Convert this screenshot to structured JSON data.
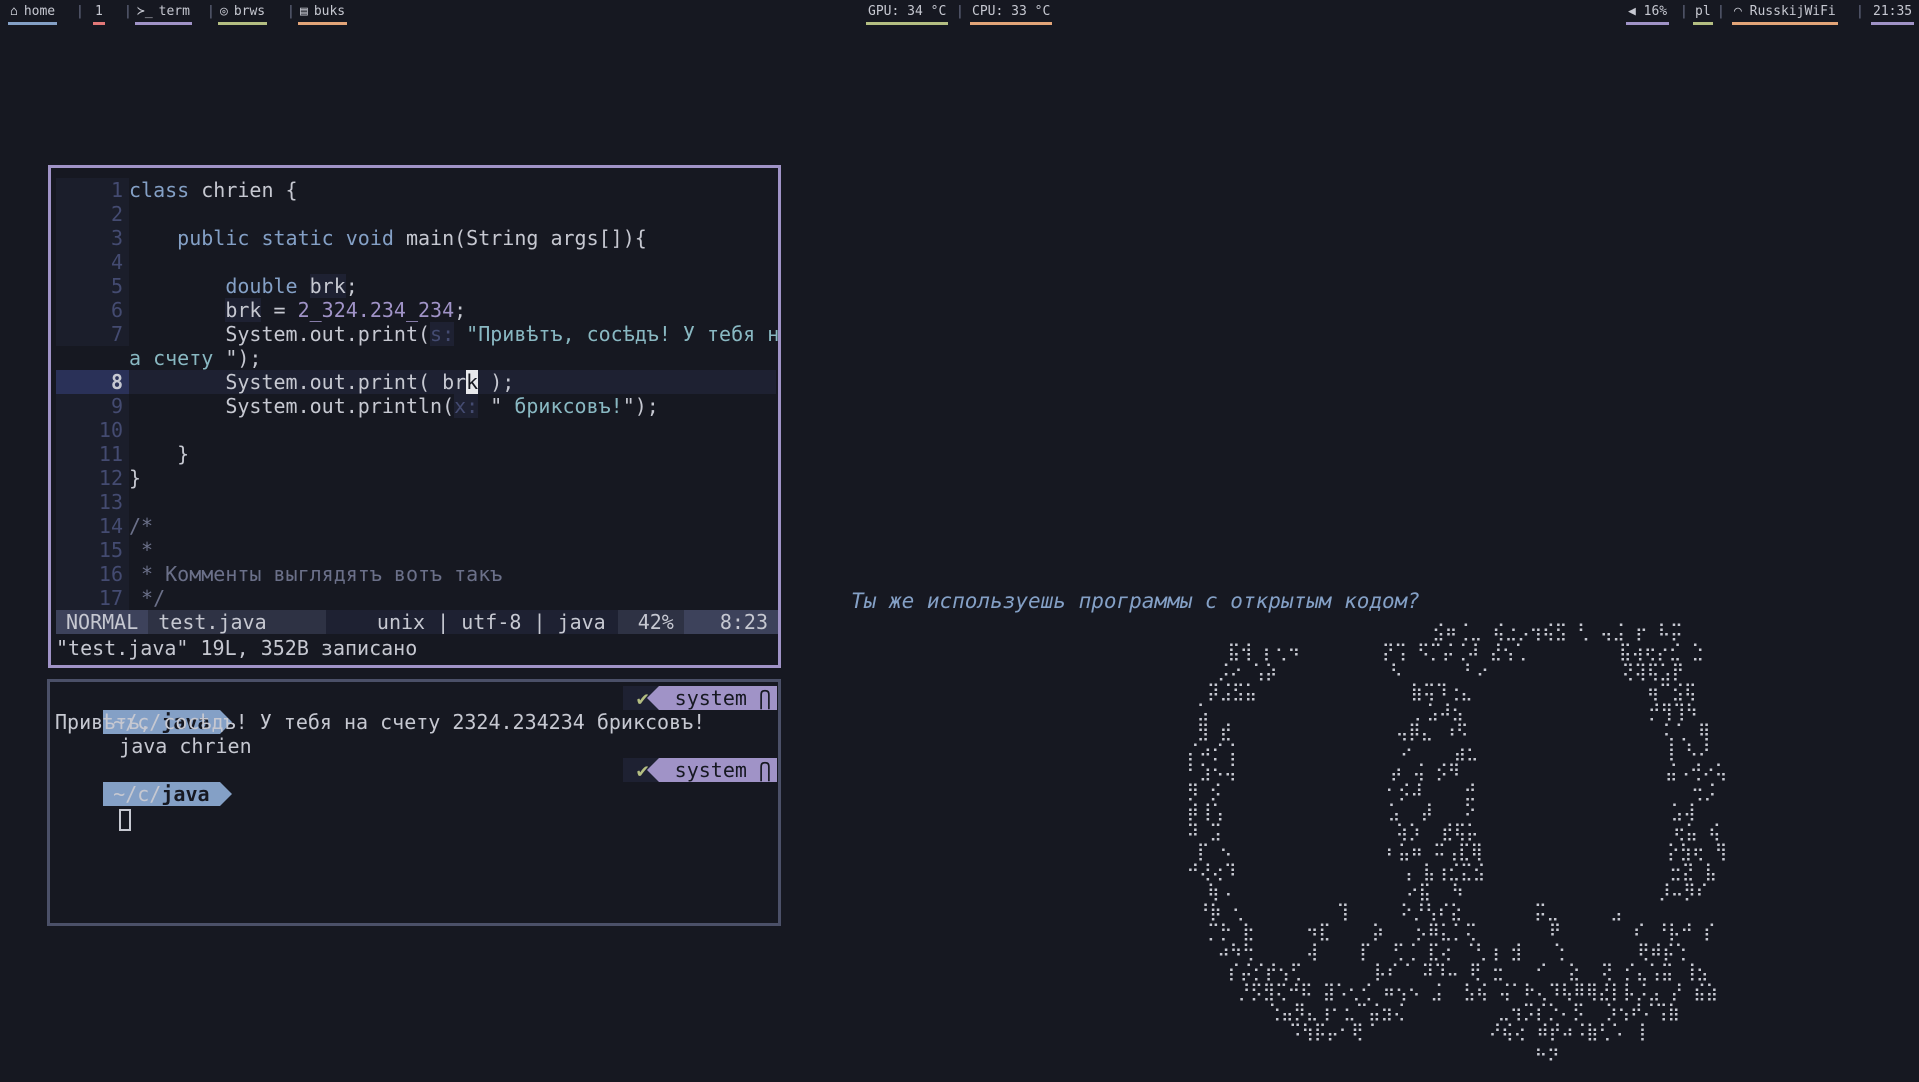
{
  "topbar": {
    "workspaces": [
      {
        "icon": "home-icon",
        "glyph": "⌂",
        "label": "home",
        "color": "#84a0c6"
      },
      {
        "icon": "",
        "glyph": "",
        "label": "1",
        "color": "#e27878"
      },
      {
        "icon": "terminal-icon",
        "glyph": "≻_",
        "label": "term",
        "color": "#a093c7"
      },
      {
        "icon": "browser-icon",
        "glyph": "◎",
        "label": "brws",
        "color": "#b4be82"
      },
      {
        "icon": "book-icon",
        "glyph": "▤",
        "label": "buks",
        "color": "#e2a478"
      }
    ],
    "gpu": "GPU: 34 °C",
    "gpu_color": "#b4be82",
    "cpu": "CPU: 33 °C",
    "cpu_color": "#e2a478",
    "volume": "16%",
    "volume_color": "#a093c7",
    "layout": "pl",
    "layout_color": "#b4be82",
    "wifi": "RusskijWiFi",
    "wifi_color": "#e2a478",
    "time": "21:35",
    "time_color": "#a093c7"
  },
  "editor": {
    "lines": [
      {
        "n": "1",
        "segs": [
          {
            "t": "class",
            "c": "kw"
          },
          {
            "t": " chrien {",
            "c": ""
          }
        ]
      },
      {
        "n": "2",
        "segs": []
      },
      {
        "n": "3",
        "segs": [
          {
            "t": "    "
          },
          {
            "t": "public static void",
            "c": "kw"
          },
          {
            "t": " main(String args[]){"
          }
        ]
      },
      {
        "n": "4",
        "segs": []
      },
      {
        "n": "5",
        "segs": [
          {
            "t": "        "
          },
          {
            "t": "double",
            "c": "kw"
          },
          {
            "t": " "
          },
          {
            "t": "brk",
            "c": "var"
          },
          {
            "t": ";"
          }
        ]
      },
      {
        "n": "6",
        "segs": [
          {
            "t": "        "
          },
          {
            "t": "brk",
            "c": "var"
          },
          {
            "t": " = "
          },
          {
            "t": "2_324.234_234",
            "c": "num"
          },
          {
            "t": ";"
          }
        ]
      },
      {
        "n": "7",
        "segs": [
          {
            "t": "        System.out.print("
          },
          {
            "t": "s:",
            "c": "hint"
          },
          {
            "t": " "
          },
          {
            "t": "\"Привѣтъ, сосѣдъ! У тебя н",
            "c": "str"
          }
        ]
      },
      {
        "n": "",
        "segs": [
          {
            "t": "а счету ",
            "c": "str"
          },
          {
            "t": "\");"
          }
        ]
      },
      {
        "n": "8",
        "cur": true,
        "segs": [
          {
            "t": "        System.out.print( br"
          },
          {
            "t": "k",
            "c": "cursor"
          },
          {
            "t": " );"
          }
        ]
      },
      {
        "n": "9",
        "segs": [
          {
            "t": "        System.out.println("
          },
          {
            "t": "x:",
            "c": "hint"
          },
          {
            "t": " \""
          },
          {
            "t": " бриксовъ!",
            "c": "str"
          },
          {
            "t": "\");"
          }
        ]
      },
      {
        "n": "10",
        "segs": []
      },
      {
        "n": "11",
        "segs": [
          {
            "t": "    }"
          }
        ]
      },
      {
        "n": "12",
        "segs": [
          {
            "t": "}"
          }
        ]
      },
      {
        "n": "13",
        "segs": []
      },
      {
        "n": "14",
        "segs": [
          {
            "t": "/*",
            "c": "cm"
          }
        ]
      },
      {
        "n": "15",
        "segs": [
          {
            "t": " *",
            "c": "cm"
          }
        ]
      },
      {
        "n": "16",
        "segs": [
          {
            "t": " * Комменты выглядятъ вотъ такъ",
            "c": "cm"
          }
        ]
      },
      {
        "n": "17",
        "segs": [
          {
            "t": " */",
            "c": "cm"
          }
        ]
      }
    ],
    "status": {
      "mode": "NORMAL",
      "file": "test.java",
      "info": "unix | utf-8 | java",
      "percent": "42%",
      "pos": "8:23"
    },
    "message": "\"test.java\" 19L, 352B записано"
  },
  "terminal": {
    "prompt_home": "~/",
    "prompt_mid": "c/",
    "prompt_dir": "java",
    "command": "java chrien",
    "output": "Привѣтъ, сосѣдъ! У тебя на счету 2324.234234 бриксовъ!",
    "check": "✔",
    "env": "system"
  },
  "quote": "Ты же используешь программы с открытым кодом?"
}
